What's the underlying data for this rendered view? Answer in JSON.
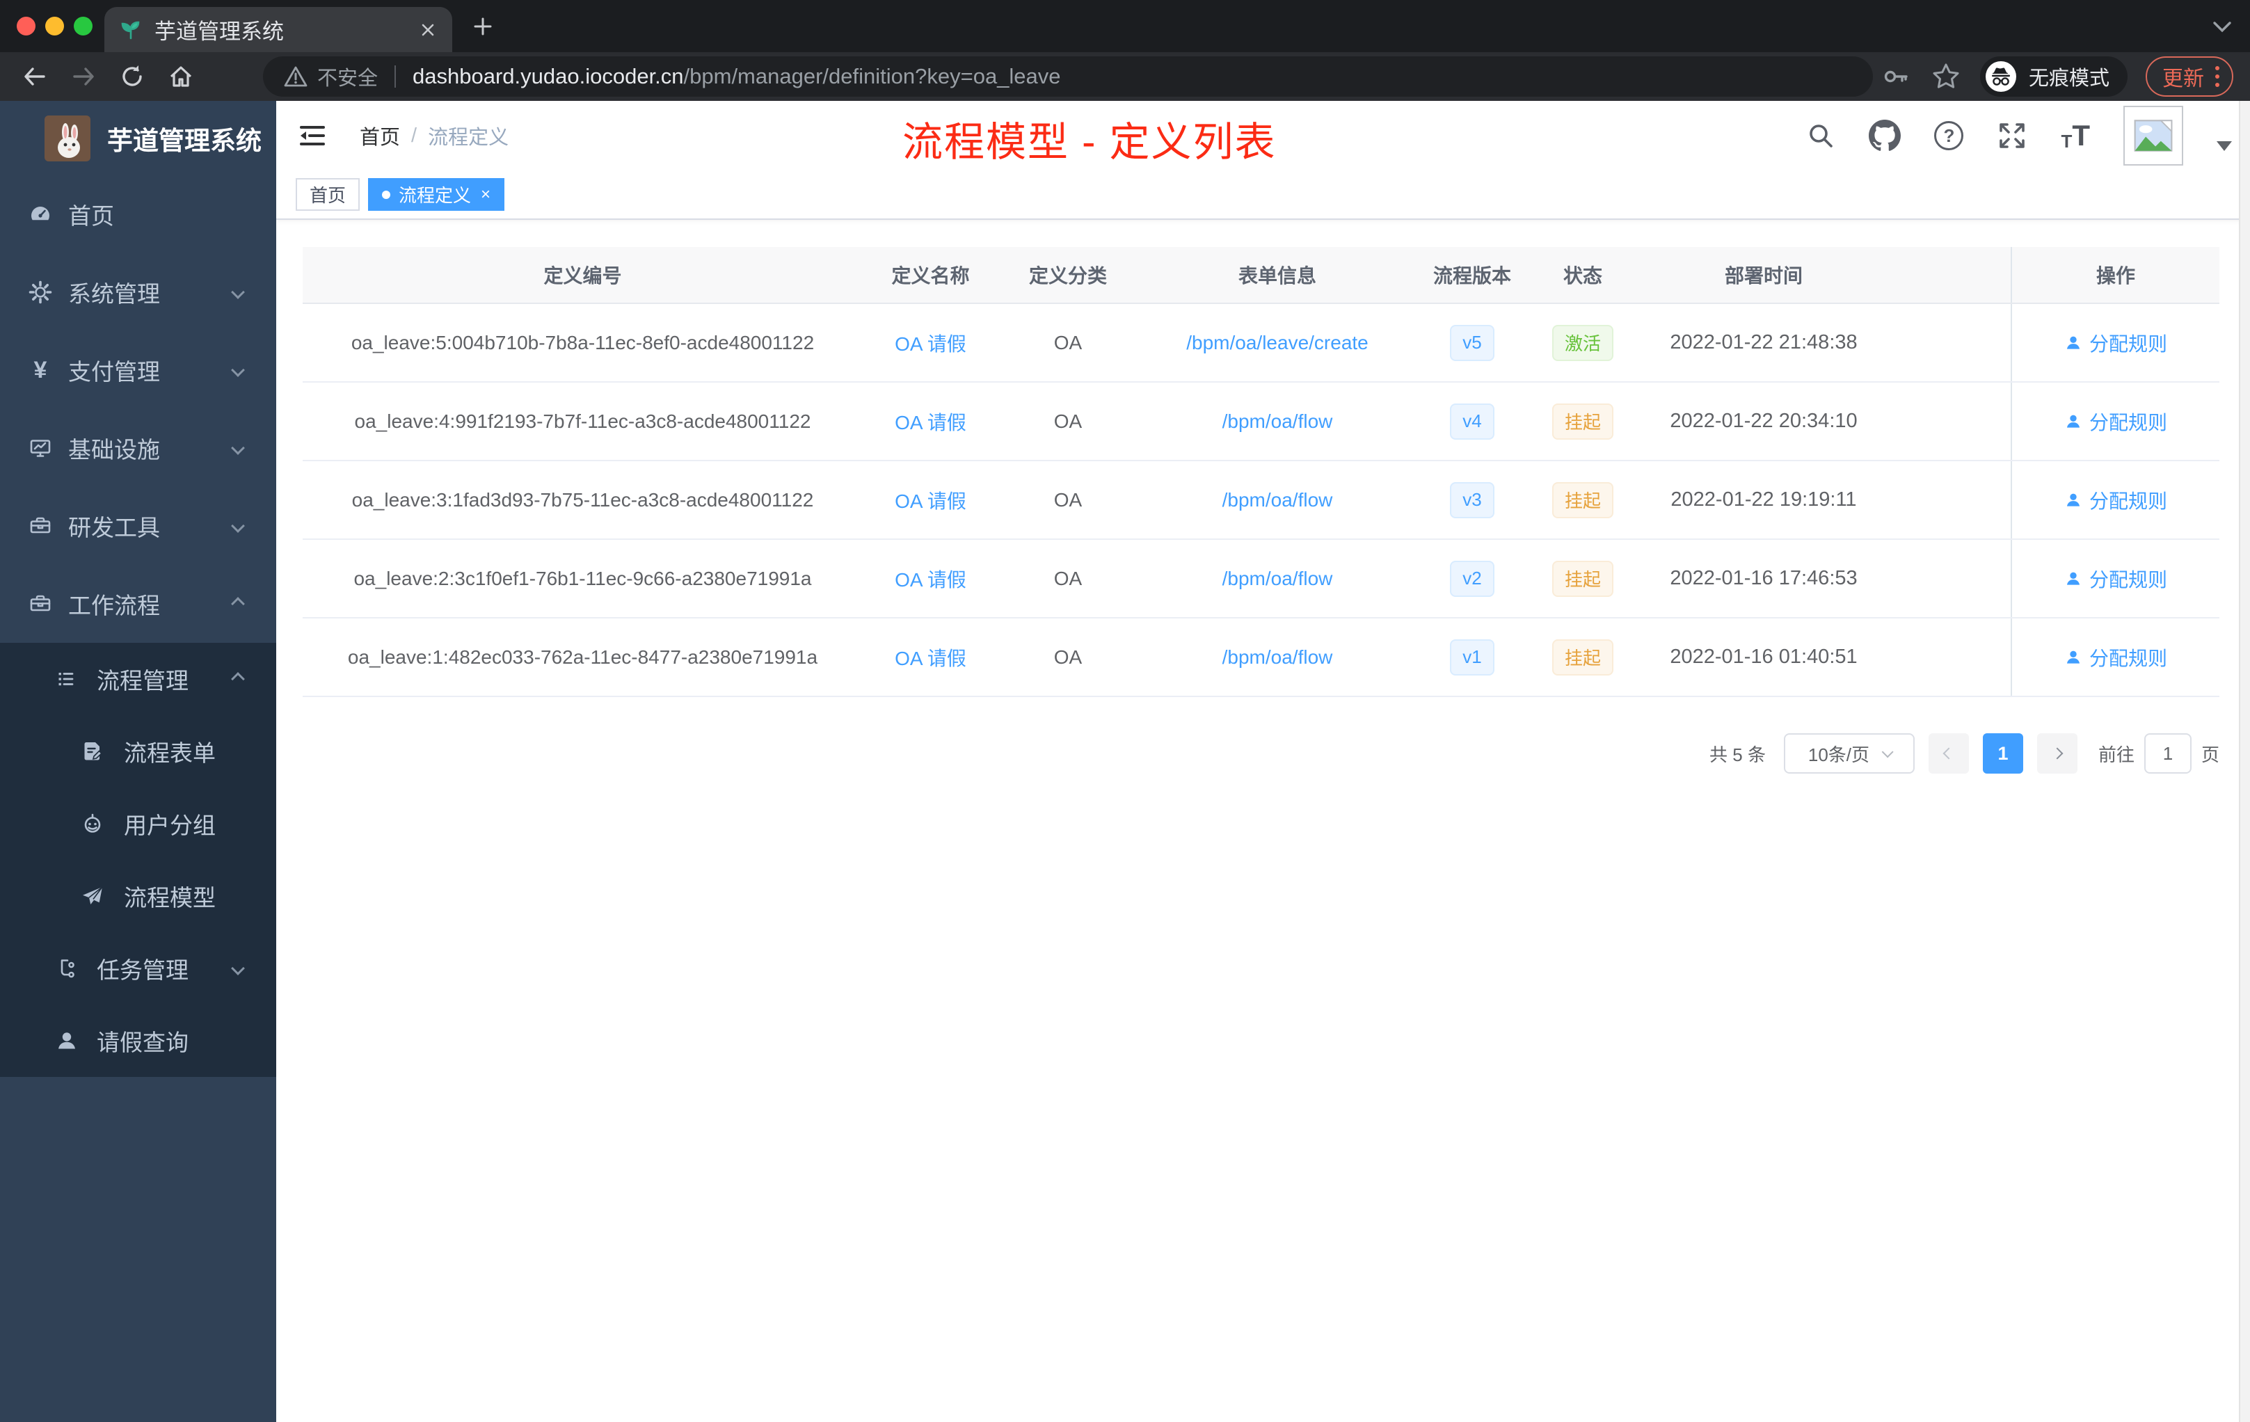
{
  "browser": {
    "tab_title": "芋道管理系统",
    "security_label": "不安全",
    "url_domain": "dashboard.yudao.iocoder.cn",
    "url_path": "/bpm/manager/definition?key=oa_leave",
    "incognito_label": "无痕模式",
    "update_label": "更新"
  },
  "sidebar": {
    "logo_title": "芋道管理系统",
    "items": [
      {
        "label": "首页",
        "icon": "dashboard",
        "level": 0,
        "chevron": null,
        "sub": false
      },
      {
        "label": "系统管理",
        "icon": "gear",
        "level": 0,
        "chevron": "down",
        "sub": false
      },
      {
        "label": "支付管理",
        "icon": "yen",
        "glyph": "¥",
        "level": 0,
        "chevron": "down",
        "sub": false
      },
      {
        "label": "基础设施",
        "icon": "monitor",
        "level": 0,
        "chevron": "down",
        "sub": false
      },
      {
        "label": "研发工具",
        "icon": "toolbox",
        "level": 0,
        "chevron": "down",
        "sub": false
      },
      {
        "label": "工作流程",
        "icon": "toolbox",
        "level": 0,
        "chevron": "up",
        "sub": false
      },
      {
        "label": "流程管理",
        "icon": "flow-list",
        "level": 1,
        "chevron": "up",
        "sub": true
      },
      {
        "label": "流程表单",
        "icon": "form-doc",
        "level": 2,
        "chevron": null,
        "sub": true
      },
      {
        "label": "用户分组",
        "icon": "robot",
        "level": 2,
        "chevron": null,
        "sub": true
      },
      {
        "label": "流程模型",
        "icon": "paper-plane",
        "level": 2,
        "chevron": null,
        "sub": true
      },
      {
        "label": "任务管理",
        "icon": "task-tree",
        "level": 1,
        "chevron": "down",
        "sub": true
      },
      {
        "label": "请假查询",
        "icon": "user",
        "level": 1,
        "chevron": null,
        "sub": true
      }
    ]
  },
  "header": {
    "breadcrumb_home": "首页",
    "breadcrumb_separator": "/",
    "breadcrumb_current": "流程定义",
    "annotation": "流程模型 - 定义列表",
    "help_glyph": "?",
    "font_icon_small": "T",
    "font_icon_large": "T"
  },
  "tags": {
    "home": "首页",
    "active": "流程定义"
  },
  "table": {
    "columns": [
      "定义编号",
      "定义名称",
      "定义分类",
      "表单信息",
      "流程版本",
      "状态",
      "部署时间",
      "操作"
    ],
    "rows": [
      {
        "id": "oa_leave:5:004b710b-7b8a-11ec-8ef0-acde48001122",
        "name": "OA 请假",
        "category": "OA",
        "form": "/bpm/oa/leave/create",
        "version": "v5",
        "status": "激活",
        "status_type": "success",
        "time": "2022-01-22 21:48:38",
        "action": "分配规则"
      },
      {
        "id": "oa_leave:4:991f2193-7b7f-11ec-a3c8-acde48001122",
        "name": "OA 请假",
        "category": "OA",
        "form": "/bpm/oa/flow",
        "version": "v4",
        "status": "挂起",
        "status_type": "warning",
        "time": "2022-01-22 20:34:10",
        "action": "分配规则"
      },
      {
        "id": "oa_leave:3:1fad3d93-7b75-11ec-a3c8-acde48001122",
        "name": "OA 请假",
        "category": "OA",
        "form": "/bpm/oa/flow",
        "version": "v3",
        "status": "挂起",
        "status_type": "warning",
        "time": "2022-01-22 19:19:11",
        "action": "分配规则"
      },
      {
        "id": "oa_leave:2:3c1f0ef1-76b1-11ec-9c66-a2380e71991a",
        "name": "OA 请假",
        "category": "OA",
        "form": "/bpm/oa/flow",
        "version": "v2",
        "status": "挂起",
        "status_type": "warning",
        "time": "2022-01-16 17:46:53",
        "action": "分配规则"
      },
      {
        "id": "oa_leave:1:482ec033-762a-11ec-8477-a2380e71991a",
        "name": "OA 请假",
        "category": "OA",
        "form": "/bpm/oa/flow",
        "version": "v1",
        "status": "挂起",
        "status_type": "warning",
        "time": "2022-01-16 01:40:51",
        "action": "分配规则"
      }
    ]
  },
  "pagination": {
    "total": "共 5 条",
    "page_size": "10条/页",
    "current_page": "1",
    "goto_label": "前往",
    "goto_value": "1",
    "unit_label": "页"
  },
  "colors": {
    "accent": "#409eff",
    "success": "#67c23a",
    "warning": "#e6a23c",
    "annotation_red": "#fb2b14",
    "sidebar_bg": "#304156",
    "submenu_bg": "#1f2d3d"
  }
}
